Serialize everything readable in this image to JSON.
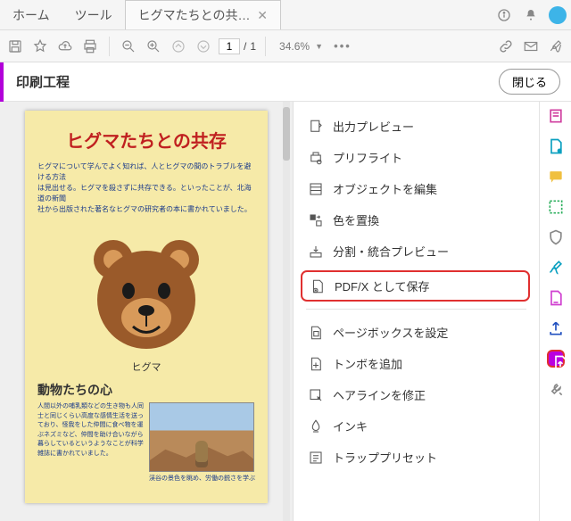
{
  "tabs": {
    "home": "ホーム",
    "tools": "ツール",
    "doc": "ヒグマたちとの共…"
  },
  "toolbar": {
    "page_current": "1",
    "page_total": "1",
    "zoom": "34.6%"
  },
  "panel": {
    "title": "印刷工程",
    "close": "閉じる"
  },
  "doc": {
    "title": "ヒグマたちとの共存",
    "body_row1": "ヒグマについて学んでよく知れば、人とヒグマの間のトラブルを避ける方法",
    "body_row2": "は見出せる。ヒグマを殺さずに共存できる。といったことが、北海道の新聞",
    "body_row3": "社から出版された著名なヒグマの研究者の本に書かれていました。",
    "bear_caption": "ヒグマ",
    "sub_heading": "動物たちの心",
    "col_text": "人間以外の哺乳類などの生き物も人同士と同じくらい高度な感情生活を送っており、怪我をした仲間に食べ物を運ぶネズミなど、仲間を助け合いながら暮らしているというようなことが科学雑誌に書かれていました。",
    "photo_caption": "渓谷の景色を眺め、労働の鋭さを学ぶ"
  },
  "side": {
    "items": [
      "出力プレビュー",
      "プリフライト",
      "オブジェクトを編集",
      "色を置換",
      "分割・統合プレビュー",
      "PDF/X として保存",
      "ページボックスを設定",
      "トンボを追加",
      "ヘアラインを修正",
      "インキ",
      "トラッププリセット"
    ]
  }
}
